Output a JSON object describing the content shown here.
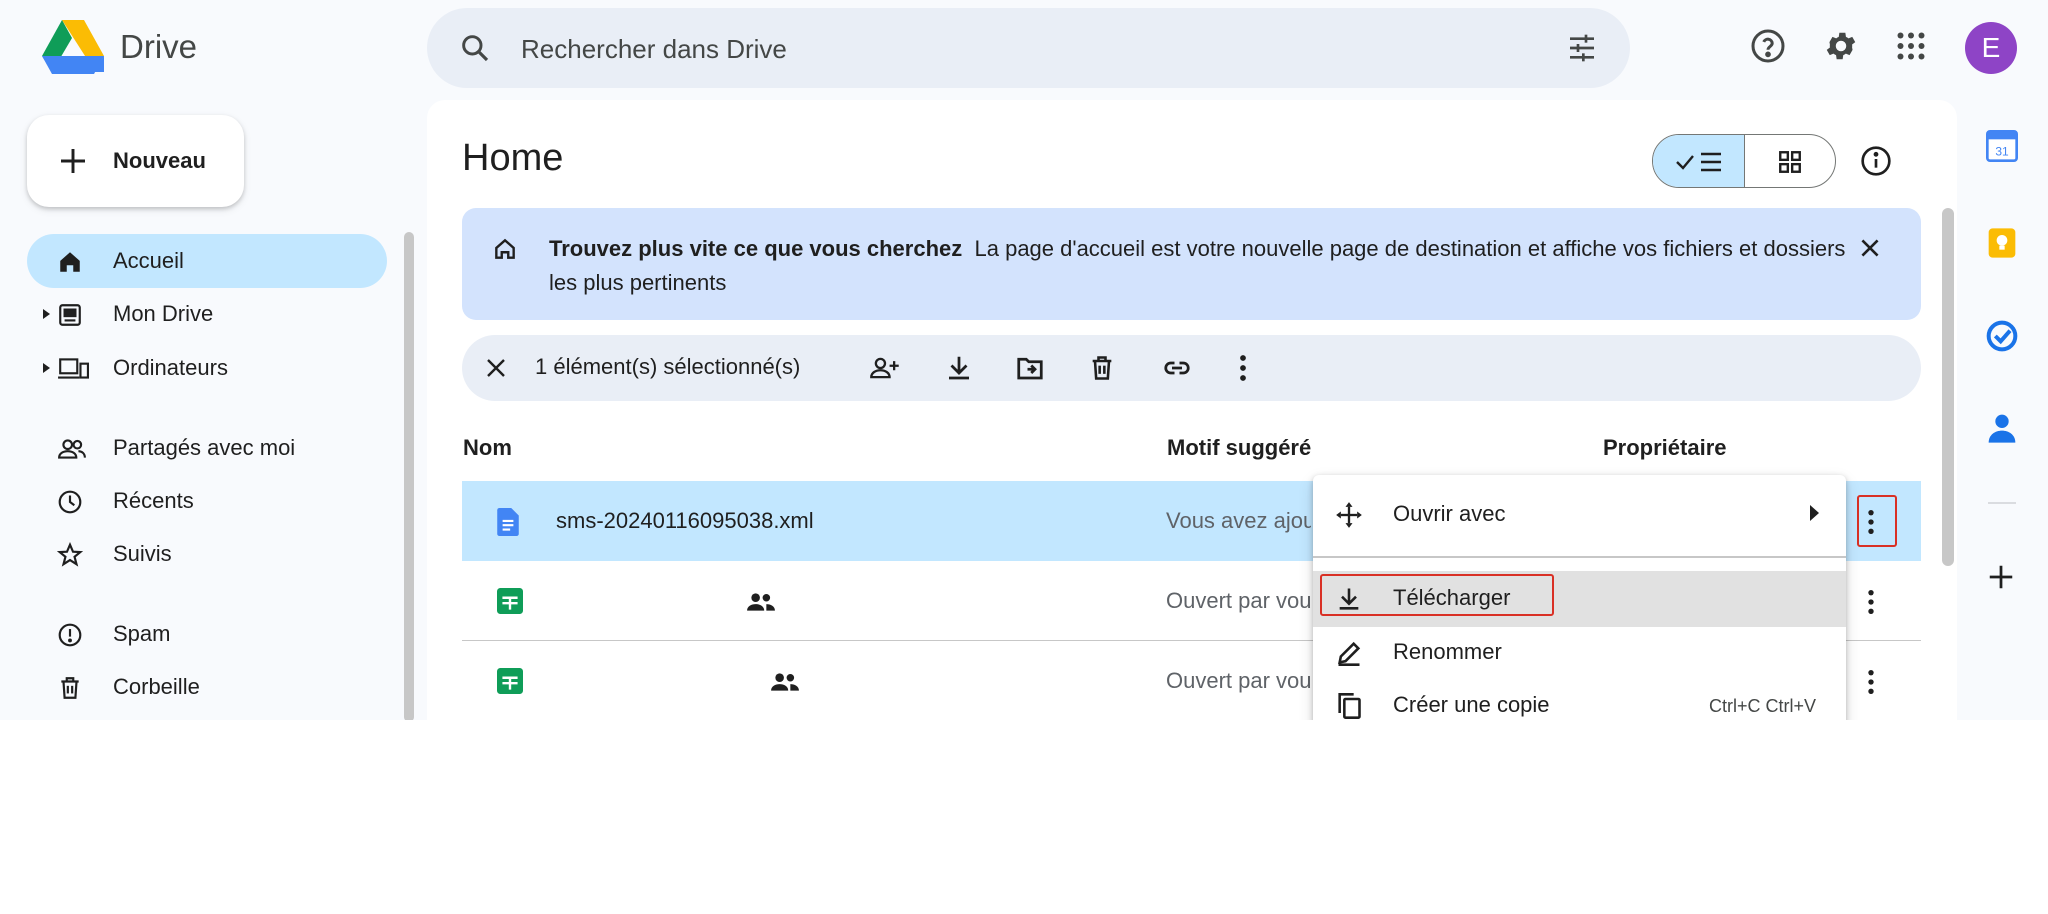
{
  "app": {
    "title": "Drive",
    "avatar_letter": "E"
  },
  "search": {
    "placeholder": "Rechercher dans Drive"
  },
  "new_button": {
    "label": "Nouveau"
  },
  "sidebar": {
    "items": [
      {
        "label": "Accueil",
        "icon": "home-icon",
        "active": true
      },
      {
        "label": "Mon Drive",
        "icon": "my-drive-icon"
      },
      {
        "label": "Ordinateurs",
        "icon": "computers-icon"
      },
      {
        "label": "Partagés avec moi",
        "icon": "shared-icon"
      },
      {
        "label": "Récents",
        "icon": "clock-icon"
      },
      {
        "label": "Suivis",
        "icon": "star-icon"
      },
      {
        "label": "Spam",
        "icon": "spam-icon"
      },
      {
        "label": "Corbeille",
        "icon": "trash-icon"
      }
    ]
  },
  "main": {
    "title": "Home",
    "banner": {
      "title": "Trouvez plus vite ce que vous cherchez",
      "text": "La page d'accueil est votre nouvelle page de destination et affiche vos fichiers et dossiers les plus pertinents"
    },
    "selection": {
      "count_text": "1 élément(s) sélectionné(s)"
    },
    "columns": {
      "name": "Nom",
      "reason": "Motif suggéré",
      "owner": "Propriétaire"
    },
    "rows": [
      {
        "name": "sms-20240116095038.xml",
        "reason": "Vous avez ajouté",
        "type": "doc",
        "selected": true
      },
      {
        "name": "",
        "reason": "Ouvert par vous",
        "type": "sheet",
        "shared": true
      },
      {
        "name": "",
        "reason": "Ouvert par vous",
        "type": "sheet",
        "shared": true
      }
    ]
  },
  "context_menu": {
    "items": [
      {
        "label": "Ouvrir avec",
        "icon": "open-with-icon",
        "submenu": true
      },
      {
        "label": "Télécharger",
        "icon": "download-icon",
        "highlighted": true
      },
      {
        "label": "Renommer",
        "icon": "rename-icon"
      },
      {
        "label": "Créer une copie",
        "icon": "copy-icon",
        "shortcut": "Ctrl+C Ctrl+V"
      }
    ]
  },
  "right_rail": {
    "calendar_day": "31"
  },
  "colors": {
    "accent": "#c2e7ff",
    "banner": "#d3e3fd",
    "highlight_border": "#d93025"
  }
}
